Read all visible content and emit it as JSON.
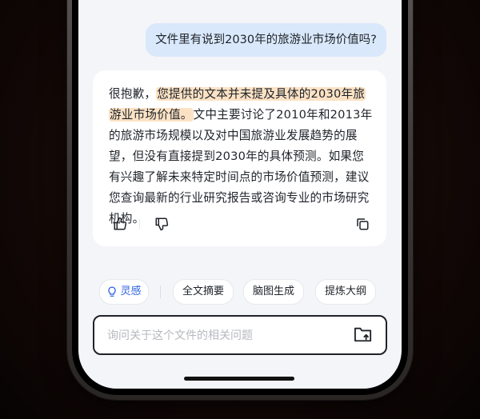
{
  "user_message": "文件里有说到2030年的旅游业市场价值吗?",
  "answer": {
    "prefix": "很抱歉，",
    "highlight": "您提供的文本并未提及具体的2030年旅游业市场价值。",
    "body": "文中主要讨论了2010年和2013年的旅游市场规模以及对中国旅游业发展趋势的展望，但没有直接提到2030年的具体预测。如果您有兴趣了解未来特定时间点的市场价值预测，建议您查询最新的行业研究报告或咨询专业的市场研究机构。"
  },
  "actions": {
    "like_icon": "thumbs-up-icon",
    "dislike_icon": "thumbs-down-icon",
    "copy_icon": "copy-icon"
  },
  "chips": {
    "inspiration": "灵感",
    "summary": "全文摘要",
    "mindmap": "脑图生成",
    "outline": "提炼大纲"
  },
  "input": {
    "placeholder": "询问关于这个文件的相关问题",
    "upload_icon": "folder-upload-icon"
  },
  "colors": {
    "accent": "#2d62e0",
    "user_bubble": "#d9e8fb",
    "highlight": "#fbe2c4"
  }
}
